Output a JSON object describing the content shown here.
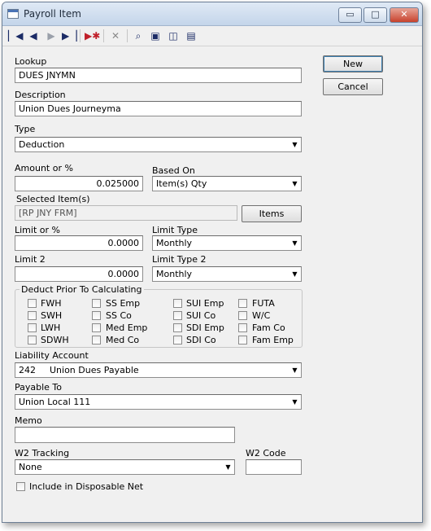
{
  "window": {
    "title": "Payroll Item"
  },
  "window_controls": {
    "minimize": "▭",
    "maximize": "□",
    "close": "✕"
  },
  "toolbar": {
    "icons": [
      "first-record-icon",
      "previous-record-icon",
      "next-record-icon",
      "last-record-icon",
      "new-record-icon",
      "delete-icon",
      "find-icon",
      "save-icon",
      "close-record-icon",
      "properties-icon"
    ]
  },
  "buttons": {
    "new": "New",
    "cancel": "Cancel",
    "items": "Items"
  },
  "fields": {
    "lookup": {
      "label": "Lookup",
      "value": "DUES JNYMN"
    },
    "description": {
      "label": "Description",
      "value": "Union Dues Journeyma"
    },
    "type": {
      "label": "Type",
      "value": "Deduction"
    },
    "amount": {
      "label": "Amount or %",
      "value": "0.025000"
    },
    "based_on": {
      "label": "Based On",
      "value": "Item(s) Qty"
    },
    "selected_items": {
      "label": "Selected Item(s)",
      "value": "[RP JNY FRM]"
    },
    "limit": {
      "label": "Limit or %",
      "value": "0.0000"
    },
    "limit_type": {
      "label": "Limit Type",
      "value": "Monthly"
    },
    "limit2": {
      "label": "Limit 2",
      "value": "0.0000"
    },
    "limit_type2": {
      "label": "Limit Type 2",
      "value": "Monthly"
    },
    "liability_account": {
      "label": "Liability Account",
      "code": "242",
      "value": "Union Dues Payable"
    },
    "payable_to": {
      "label": "Payable To",
      "value": "Union Local 111"
    },
    "memo": {
      "label": "Memo",
      "value": ""
    },
    "w2_tracking": {
      "label": "W2 Tracking",
      "value": "None"
    },
    "w2_code": {
      "label": "W2 Code",
      "value": ""
    }
  },
  "deduct_prior": {
    "title": "Deduct Prior To Calculating",
    "columns": [
      [
        "FWH",
        "SWH",
        "LWH",
        "SDWH"
      ],
      [
        "SS Emp",
        "SS Co",
        "Med Emp",
        "Med Co"
      ],
      [
        "SUI Emp",
        "SUI Co",
        "SDI Emp",
        "SDI Co"
      ],
      [
        "FUTA",
        "W/C",
        "Fam Co",
        "Fam Emp"
      ]
    ]
  },
  "include_disposable": {
    "label": "Include in Disposable Net",
    "checked": false
  }
}
